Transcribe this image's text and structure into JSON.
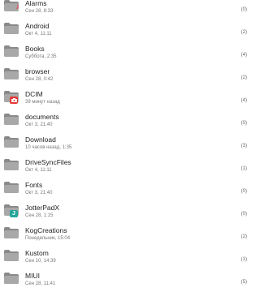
{
  "colors": {
    "folder": "#8a8a8a",
    "folder_tab": "#a8a8a8",
    "music_accent": "#e53935",
    "dcim_badge": "#e53935",
    "jotter_badge": "#26a69a"
  },
  "folders": [
    {
      "name": "Alarms",
      "date": "Сен 28, 8:33",
      "count": "(0)",
      "icon": "music-note-icon"
    },
    {
      "name": "Android",
      "date": "Окт 4, 11:11",
      "count": "(2)"
    },
    {
      "name": "Books",
      "date": "Суббота, 2:35",
      "count": "(4)"
    },
    {
      "name": "browser",
      "date": "Сен 28, 0:42",
      "count": "(2)"
    },
    {
      "name": "DCIM",
      "date": "39 минут назад",
      "count": "(4)",
      "icon": "camera-icon"
    },
    {
      "name": "documents",
      "date": "Окт 3, 21:40",
      "count": "(0)"
    },
    {
      "name": "Download",
      "date": "10 часов назад, 1:35",
      "count": "(3)"
    },
    {
      "name": "DriveSyncFiles",
      "date": "Окт 4, 11:11",
      "count": "(1)"
    },
    {
      "name": "Fonts",
      "date": "Окт 3, 21:40",
      "count": "(0)"
    },
    {
      "name": "JotterPadX",
      "date": "Сен 28, 1:15",
      "count": "(0)",
      "icon": "jotterpad-icon",
      "badge_text": "J"
    },
    {
      "name": "KogCreations",
      "date": "Понедельник, 15:04",
      "count": "(2)"
    },
    {
      "name": "Kustom",
      "date": "Сен 10, 14:39",
      "count": "(1)"
    },
    {
      "name": "MIUI",
      "date": "Сен 28, 11:41",
      "count": "(5)"
    }
  ]
}
